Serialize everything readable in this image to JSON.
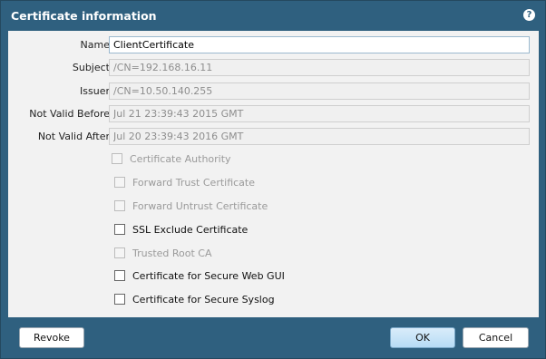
{
  "dialog": {
    "title": "Certificate information",
    "help_icon": "?"
  },
  "fields": [
    {
      "label": "Name",
      "value": "ClientCertificate"
    },
    {
      "label": "Subject",
      "value": "/CN=192.168.16.11"
    },
    {
      "label": "Issuer",
      "value": "/CN=10.50.140.255"
    },
    {
      "label": "Not Valid Before",
      "value": "Jul 21 23:39:43 2015 GMT"
    },
    {
      "label": "Not Valid After",
      "value": "Jul 20 23:39:43 2016 GMT"
    }
  ],
  "checkboxes": [
    {
      "label": "Certificate Authority",
      "enabled": false,
      "checked": false
    },
    {
      "label": "Forward Trust Certificate",
      "enabled": false,
      "checked": false
    },
    {
      "label": "Forward Untrust Certificate",
      "enabled": false,
      "checked": false
    },
    {
      "label": "SSL Exclude Certificate",
      "enabled": true,
      "checked": false
    },
    {
      "label": "Trusted Root CA",
      "enabled": false,
      "checked": false
    },
    {
      "label": "Certificate for Secure Web GUI",
      "enabled": true,
      "checked": false
    },
    {
      "label": "Certificate for Secure Syslog",
      "enabled": true,
      "checked": false
    }
  ],
  "buttons": {
    "revoke": "Revoke",
    "ok": "OK",
    "cancel": "Cancel"
  }
}
